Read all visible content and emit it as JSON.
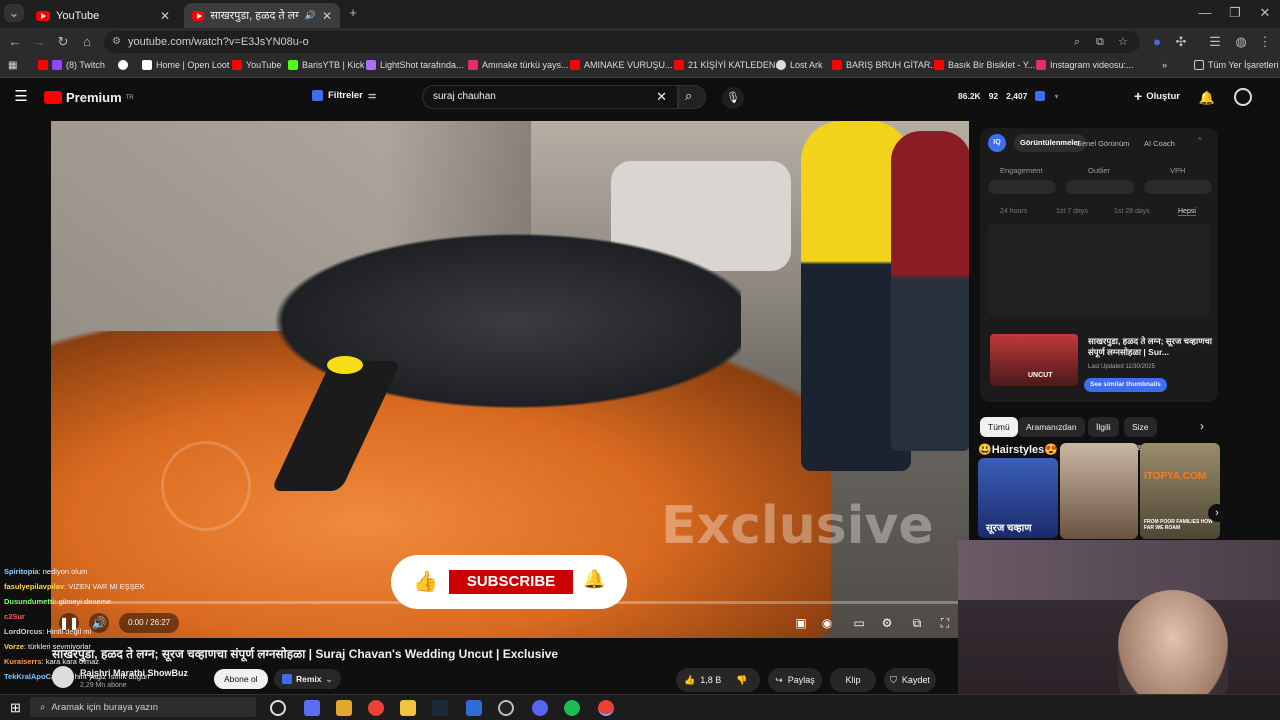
{
  "browser": {
    "tabs": [
      {
        "label": "YouTube",
        "active": false
      },
      {
        "label": "साखरपुडा, हळद ते लग्न; सूरज",
        "active": true
      }
    ],
    "url": "youtube.com/watch?v=E3JsYN08u-o",
    "bookmarks": [
      {
        "label": "(8) Twitch",
        "color": "#9146ff"
      },
      {
        "label": "Home | Open Loot",
        "color": "#ffffff"
      },
      {
        "label": "YouTube",
        "color": "#ff0000"
      },
      {
        "label": "BarisYTB | Kick",
        "color": "#53fc18"
      },
      {
        "label": "LightShot tarafında...",
        "color": "#a970ff"
      },
      {
        "label": "Amınake türkü yays...",
        "color": "#e1306c"
      },
      {
        "label": "AMINAKE VURUŞU...",
        "color": "#ff0000"
      },
      {
        "label": "21 KİŞİYİ KATLEDEN...",
        "color": "#ff0000"
      },
      {
        "label": "Lost Ark",
        "color": "#dddddd"
      },
      {
        "label": "BARIŞ BRUH GİTAR...",
        "color": "#ff0000"
      },
      {
        "label": "Basık Bir Bisiklet - Y...",
        "color": "#ff0000"
      },
      {
        "label": "Instagram videosu:...",
        "color": "#e1306c"
      }
    ],
    "all_bookmarks": "Tüm Yer İşaretleri"
  },
  "header": {
    "logo": "Premium",
    "logo_sup": "TR",
    "filters": "Filtreler",
    "search_value": "suraj chauhan",
    "stats": [
      "86.2K",
      "92",
      "2,407"
    ],
    "create": "Oluştur"
  },
  "video": {
    "watermark": "Exclusive",
    "subscribe": "SUBSCRIBE",
    "time": "0:00 / 26:27",
    "title": "साखरपुडा, हळद ते लग्न; सूरज चव्हाणचा संपूर्ण लग्नसोहळा | Suraj Chavan's Wedding Uncut | Exclusive",
    "channel": "Rajshri Marathi ShowBuz",
    "subs": "2,29 Mn abone",
    "subscribe_btn": "Abone ol",
    "remix": "Remix",
    "likes": "1,8 B",
    "share": "Paylaş",
    "clip": "Klip",
    "save": "Kaydet"
  },
  "chat": [
    {
      "user": "Spiritopia",
      "msg": ": nediyon olum",
      "color": "#8ad4ff"
    },
    {
      "user": "fasulyepilavpilav",
      "msg": ": VİZEN VAR MI EŞŞEK",
      "color": "#ffd54a"
    },
    {
      "user": "Dusundumetti",
      "msg": ": gilmeyi deneme",
      "color": "#7cff7c"
    },
    {
      "user": "c3Sur",
      "msg": "",
      "color": "#ff5b5b"
    },
    {
      "user": "LordOrcus",
      "msg": ": Hintli değil mi",
      "color": "#cfcfcf"
    },
    {
      "user": "Vorze",
      "msg": ": türkleri sevmiyorlar",
      "color": "#ffd54a"
    },
    {
      "user": "Kuraiserrs",
      "msg": ": kara kara olmaz",
      "color": "#ff9b4a"
    },
    {
      "user": "TekKralApoCanimi",
      "msg": ": hint yagiz ısınık düğün",
      "color": "#7cc6ff"
    }
  ],
  "iq_panel": {
    "tabs": [
      "Görüntülenmeler",
      "Genel Görünüm",
      "AI Coach"
    ],
    "metrics": [
      "Engagement",
      "Outlier",
      "VPH"
    ],
    "ranges": [
      "24 hours",
      "1st 7 days",
      "1st 28 days",
      "Hepsi"
    ],
    "rec_title": "साखरपुडा, हळद ते लग्न; सूरज चव्हाणचा संपूर्ण लग्नसोहळा | Sur...",
    "rec_updated": "Last Updated 11/30/2025",
    "rec_button": "See similar thumbnails",
    "thumb_label": "UNCUT"
  },
  "chips": [
    "Tümü",
    "Aramanızdan",
    "İlgili",
    "Size özel"
  ],
  "shelf": {
    "title": "😃Hairstyles😍",
    "thumb1_caption": "सूरज चव्हाण",
    "thumb3_brand": "ITOPYA.COM",
    "thumb3_caption": "FROM POOR FAMILIES HOW FAR WE ROAM"
  },
  "taskbar": {
    "search": "Aramak için buraya yazın"
  },
  "colors": {
    "accent_red": "#ff0000",
    "subscribe_red": "#cc0000",
    "iq_blue": "#3d6ef2",
    "chip_bg": "#272727"
  }
}
